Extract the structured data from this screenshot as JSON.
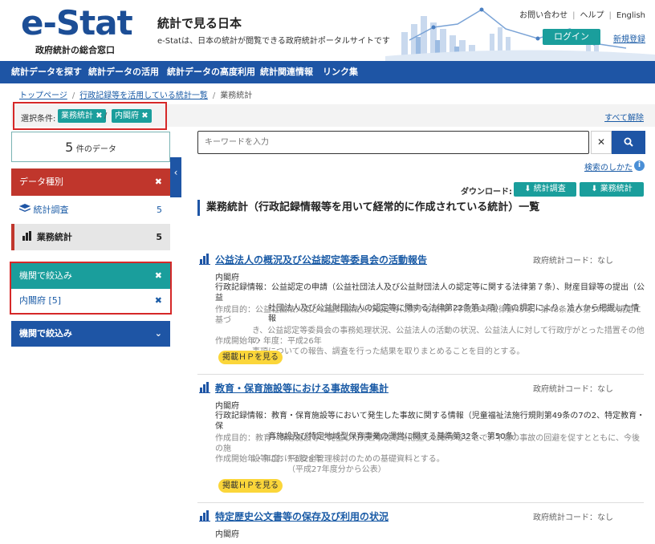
{
  "header": {
    "logo_text": "e-Stat",
    "logo_sub": "政府統計の総合窓口",
    "site_title": "統計で見る日本",
    "site_desc": "e-Statは、日本の統計が閲覧できる政府統計ポータルサイトです",
    "links": [
      "お問い合わせ",
      "ヘルプ",
      "English"
    ],
    "login": "ログイン",
    "register": "新規登録"
  },
  "nav": [
    "統計データを探す",
    "統計データの活用",
    "統計データの高度利用",
    "統計関連情報",
    "リンク集"
  ],
  "breadcrumb": [
    "トップページ",
    "行政記録等を活用している統計一覧",
    "業務統計"
  ],
  "condition": {
    "label": "選択条件:",
    "tags": [
      "業務統計",
      "内閣府"
    ],
    "sep": "/",
    "clear_all": "すべて解除"
  },
  "count": {
    "num": "5",
    "unit": "件のデータ"
  },
  "data_type": {
    "title": "データ種別",
    "items": [
      {
        "label": "統計調査",
        "count": "5"
      },
      {
        "label": "業務統計",
        "count": "5"
      }
    ]
  },
  "org_filter": {
    "title": "機関で絞込み",
    "item": "内閣府 [5]"
  },
  "org_filter2": {
    "title": "機関で絞込み"
  },
  "search": {
    "placeholder": "キーワードを入力",
    "howto": "検索のしかた"
  },
  "download": {
    "label": "ダウンロード:",
    "btn1": "統計調査",
    "btn2": "業務統計"
  },
  "list_title": "業務統計（行政記録情報等を用いて経常的に作成されている統計）一覧",
  "items": [
    {
      "title": "公益法人の概況及び公益認定等委員会の活動報告",
      "code": "政府統計コード：なし",
      "agency": "内閣府",
      "record_1": "行政記録情報：公益認定の申請（公益社団法人及び公益財団法人の認定等に関する法律第７条）、財産目録等の提出（公益",
      "record_2": "社団法人及び公益財団法人の認定等に関する法律第22条第１項）等の規定により、法人から把握した情報",
      "purpose_1": "作成目的：公益社団法人及び公益財団法人の認定等に関する法律（平成18年法律第49号）第48条及び第57条の規定に基づ",
      "purpose_2": "き、公益認定等委員会の事務処理状況、公益法人の活動の状況、公益法人に対して行政庁がとった措置その他の",
      "purpose_3": "事項についての報告、調査を行った結果を取りまとめることを目的とする。",
      "start": "作成開始年・年度：平成26年",
      "hp": "掲載ＨＰを見る"
    },
    {
      "title": "教育・保育施設等における事故報告集計",
      "code": "政府統計コード：なし",
      "agency": "内閣府",
      "record_1": "行政記録情報：教育・保育施設等において発生した事故に関する情報（児童福祉法施行規則第49条の7の2、特定教育・保",
      "record_2": "育施設及び特定地域型保育事業の運営に関する基準第32条、第50条）",
      "purpose_1": "作成目的：教育・保育施設等で発生した死亡事故等を把握し公表することで、不適の事故の回避を促すとともに、今後の施",
      "purpose_2": "設等における安全管理検討のための基礎資料とする。",
      "start": "作成開始年・年度：平成28年",
      "start_2": "（平成27年度分から公表）",
      "hp": "掲載ＨＰを見る"
    },
    {
      "title": "特定歴史公文書等の保存及び利用の状況",
      "code": "政府統計コード：なし",
      "agency": "内閣府"
    }
  ]
}
